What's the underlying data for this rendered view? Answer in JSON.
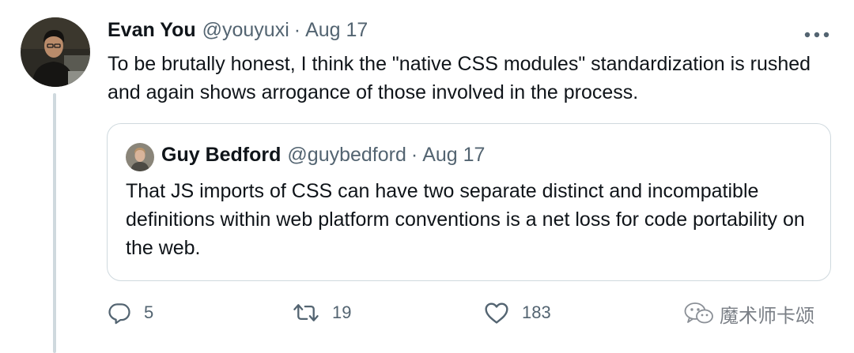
{
  "tweet": {
    "author_name": "Evan You",
    "author_handle": "@youyuxi",
    "separator": "·",
    "date": "Aug 17",
    "text": "To be brutally honest, I think the \"native CSS modules\" standardization is rushed and again shows arrogance of those involved in the process.",
    "avatar_icon": "person-photo-avatar"
  },
  "quote": {
    "author_name": "Guy Bedford",
    "author_handle": "@guybedford",
    "separator": "·",
    "date": "Aug 17",
    "text": "That JS imports of CSS can have two separate distinct and incompatible definitions within web platform conventions is a net loss for code portability on the web.",
    "avatar_icon": "person-photo-avatar"
  },
  "actions": {
    "reply_count": "5",
    "retweet_count": "19",
    "like_count": "183"
  },
  "watermark": {
    "text": "魔术师卡颂",
    "icon": "wechat-icon"
  },
  "colors": {
    "text": "#0f1419",
    "secondary": "#536471",
    "border": "#cfd9de"
  }
}
